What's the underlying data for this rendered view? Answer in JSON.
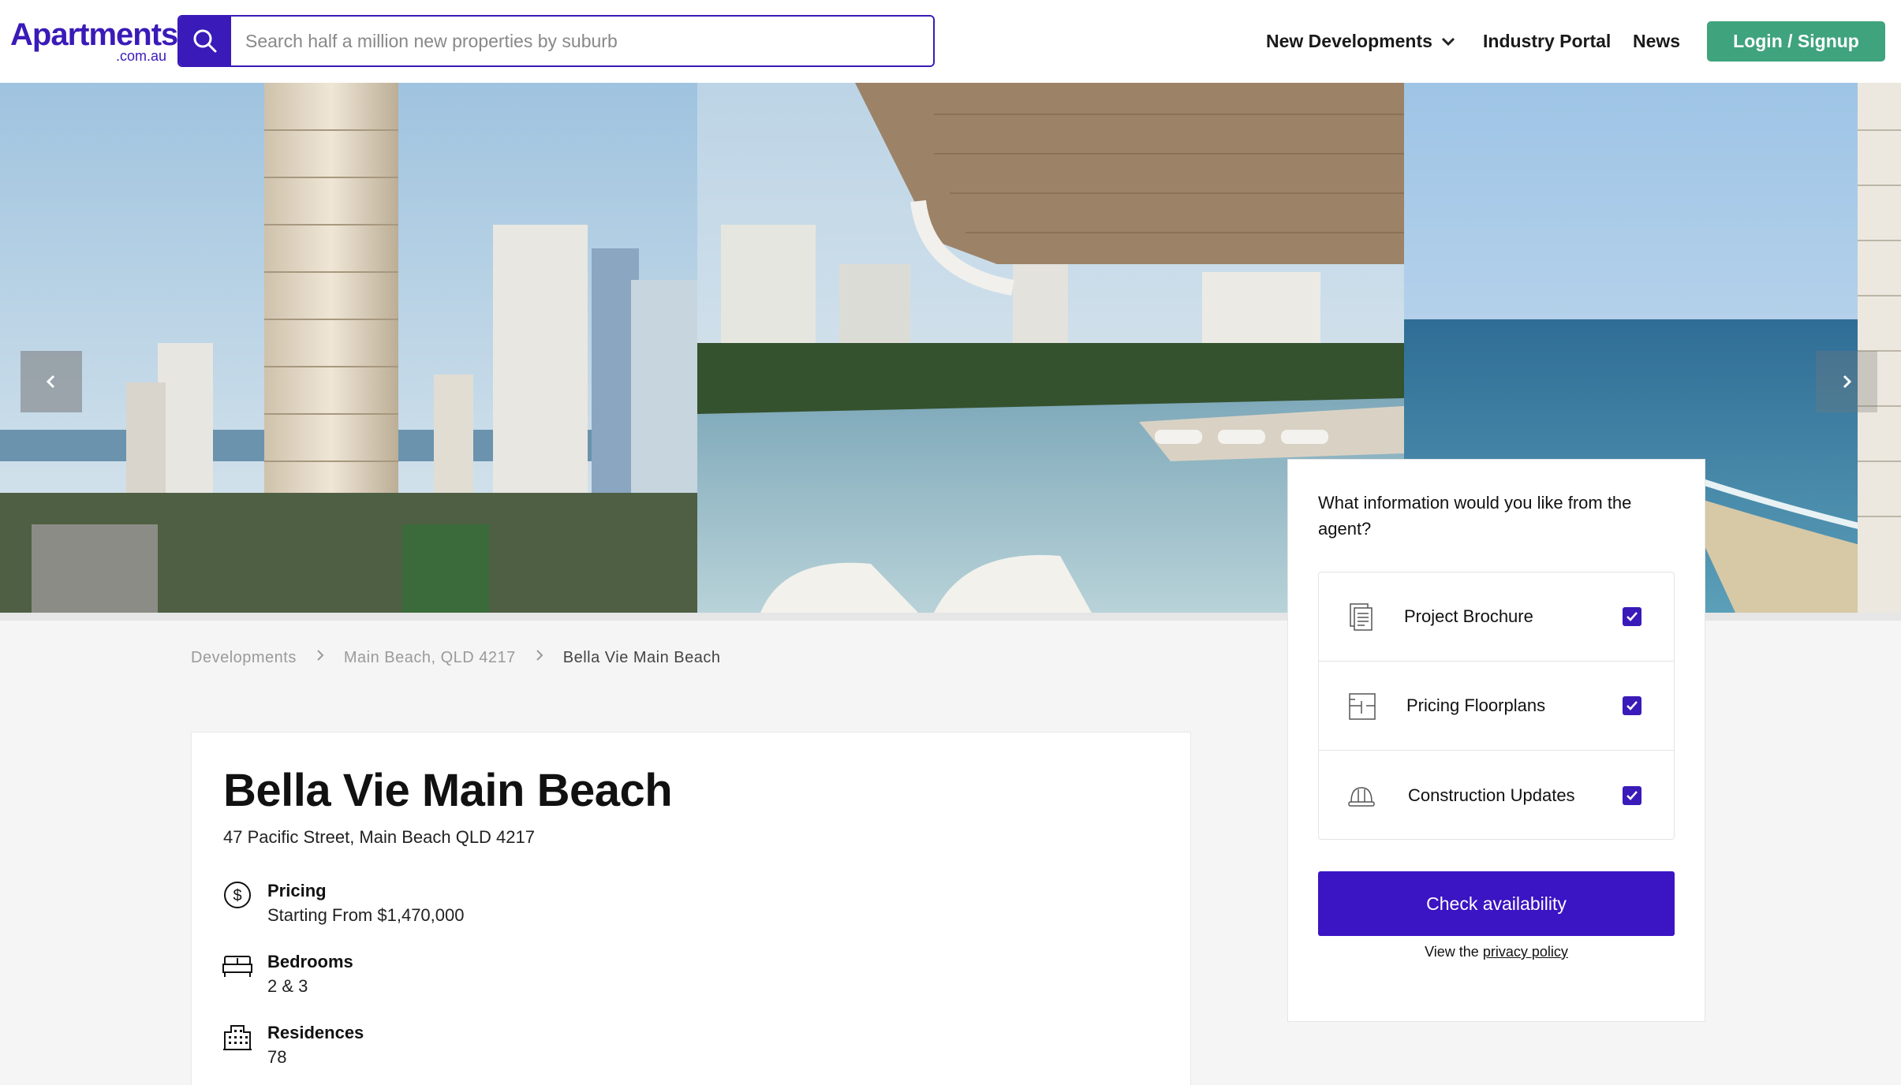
{
  "brand": {
    "name": "Apartments",
    "tld": ".com.au",
    "color": "#3a1ab8"
  },
  "search": {
    "placeholder": "Search half a million new properties by suburb",
    "value": ""
  },
  "nav": {
    "new_developments": "New Developments",
    "industry_portal": "Industry Portal",
    "news": "News",
    "login": "Login / Signup"
  },
  "breadcrumb": {
    "items": [
      "Developments",
      "Main Beach, QLD 4217",
      "Bella Vie Main Beach"
    ]
  },
  "listing": {
    "title": "Bella Vie Main Beach",
    "address": "47 Pacific Street, Main Beach QLD 4217",
    "features": [
      {
        "icon": "dollar-icon",
        "label": "Pricing",
        "value": "Starting From $1,470,000"
      },
      {
        "icon": "bed-icon",
        "label": "Bedrooms",
        "value": "2 & 3"
      },
      {
        "icon": "building-icon",
        "label": "Residences",
        "value": "78"
      }
    ]
  },
  "enquiry": {
    "question": "What information would you like from the agent?",
    "options": [
      {
        "icon": "brochure-icon",
        "label": "Project Brochure",
        "checked": true
      },
      {
        "icon": "floorplan-icon",
        "label": "Pricing Floorplans",
        "checked": true
      },
      {
        "icon": "hardhat-icon",
        "label": "Construction Updates",
        "checked": true
      }
    ],
    "cta": "Check availability",
    "privacy_prefix": "View the",
    "privacy_link": "privacy policy"
  },
  "colors": {
    "accent": "#3a1ab8",
    "cta": "#3b14c4",
    "login": "#3fa37d"
  }
}
